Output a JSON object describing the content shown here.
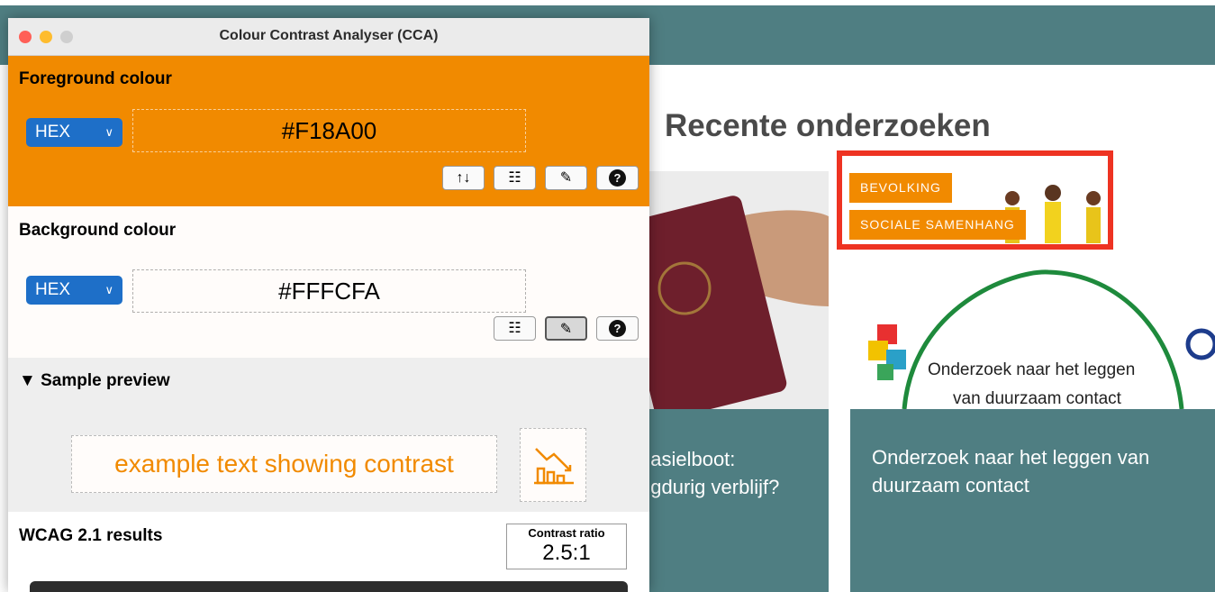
{
  "web_page": {
    "heading": "Recente onderzoeken",
    "card1_title_line1": "f asielboot:",
    "card1_title_line2": "ngdurig verblijf?",
    "card2_tags": [
      "BEVOLKING",
      "SOCIALE SAMENHANG"
    ],
    "card2_image_caption_line1": "Onderzoek naar het leggen",
    "card2_image_caption_line2": "van duurzaam contact",
    "card2_title": "Onderzoek naar het leggen van duurzaam contact"
  },
  "window": {
    "title": "Colour Contrast Analyser (CCA)"
  },
  "foreground": {
    "label": "Foreground colour",
    "format": "HEX",
    "value": "#F18A00",
    "tools": [
      "swap-icon",
      "sliders-icon",
      "eyedropper-icon",
      "help-icon"
    ]
  },
  "background": {
    "label": "Background colour",
    "format": "HEX",
    "value": "#FFFCFA",
    "tools": [
      "sliders-icon",
      "eyedropper-icon",
      "help-icon"
    ]
  },
  "sample": {
    "label": "▼ Sample preview",
    "text": "example text showing contrast",
    "graphic_icon": "chart-icon"
  },
  "results": {
    "label": "WCAG 2.1 results",
    "ratio_label": "Contrast ratio",
    "ratio_value": "2.5:1"
  },
  "colors": {
    "foreground": "#F18A00",
    "background": "#FFFCFA",
    "page_teal": "#4F7E82",
    "highlight": "#EE3322",
    "select_blue": "#1E6FC8"
  }
}
